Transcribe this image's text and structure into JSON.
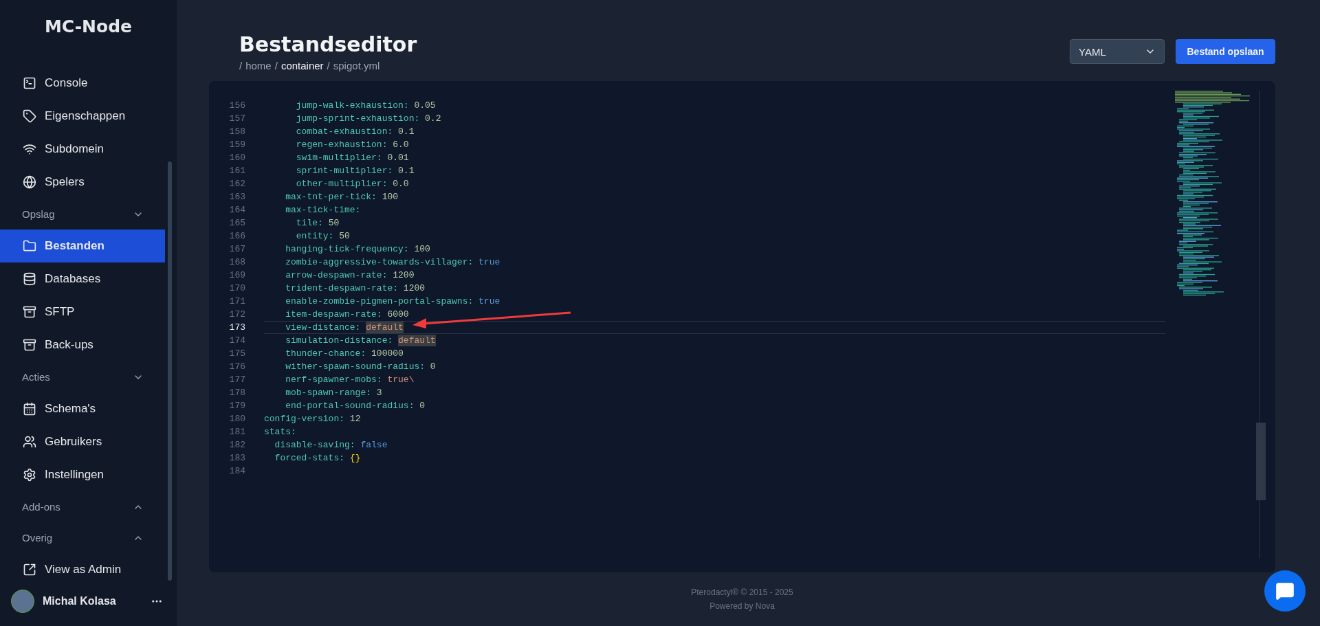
{
  "sidebar": {
    "logo": "MC-Node",
    "groups": [
      {
        "items": [
          {
            "label": "Console",
            "selected": false
          },
          {
            "label": "Eigenschappen",
            "selected": false
          },
          {
            "label": "Subdomein",
            "selected": false
          },
          {
            "label": "Spelers",
            "selected": false
          }
        ]
      },
      {
        "label": "Opslag",
        "expanded": true,
        "items": [
          {
            "label": "Bestanden",
            "selected": true
          },
          {
            "label": "Databases",
            "selected": false
          },
          {
            "label": "SFTP",
            "selected": false
          },
          {
            "label": "Back-ups",
            "selected": false
          }
        ]
      },
      {
        "label": "Acties",
        "expanded": true,
        "items": [
          {
            "label": "Schema's",
            "selected": false
          },
          {
            "label": "Gebruikers",
            "selected": false
          },
          {
            "label": "Instellingen",
            "selected": false
          }
        ]
      },
      {
        "label": "Add-ons",
        "expanded": false
      },
      {
        "label": "Overig",
        "expanded": false,
        "items": [
          {
            "label": "View as Admin",
            "selected": false
          }
        ]
      }
    ],
    "user": {
      "name": "Michal Kolasa"
    }
  },
  "header": {
    "title": "Bestandseditor",
    "breadcrumb": [
      {
        "label": "home",
        "highlighted": false
      },
      {
        "label": "container",
        "highlighted": true
      },
      {
        "label": "spigot.yml",
        "highlighted": false
      }
    ],
    "separator": "/",
    "language": "YAML",
    "save_button": "Bestand opslaan"
  },
  "editor": {
    "lines": [
      {
        "num": "156",
        "key": "      jump-walk-exhaustion:",
        "value": "0.05",
        "kind": "number",
        "current": false
      },
      {
        "num": "157",
        "key": "      jump-sprint-exhaustion:",
        "value": "0.2",
        "kind": "number",
        "current": false
      },
      {
        "num": "158",
        "key": "      combat-exhaustion:",
        "value": "0.1",
        "kind": "number",
        "current": false
      },
      {
        "num": "159",
        "key": "      regen-exhaustion:",
        "value": "6.0",
        "kind": "number",
        "current": false
      },
      {
        "num": "160",
        "key": "      swim-multiplier:",
        "value": "0.01",
        "kind": "number",
        "current": false
      },
      {
        "num": "161",
        "key": "      sprint-multiplier:",
        "value": "0.1",
        "kind": "number",
        "current": false
      },
      {
        "num": "162",
        "key": "      other-multiplier:",
        "value": "0.0",
        "kind": "number",
        "current": false
      },
      {
        "num": "163",
        "key": "    max-tnt-per-tick:",
        "value": "100",
        "kind": "number",
        "current": false
      },
      {
        "num": "164",
        "key": "    max-tick-time:",
        "kind": "none",
        "current": false
      },
      {
        "num": "165",
        "key": "      tile:",
        "value": "50",
        "kind": "number",
        "current": false
      },
      {
        "num": "166",
        "key": "      entity:",
        "value": "50",
        "kind": "number",
        "current": false
      },
      {
        "num": "167",
        "key": "    hanging-tick-frequency:",
        "value": "100",
        "kind": "number",
        "current": false
      },
      {
        "num": "168",
        "key": "    zombie-aggressive-towards-villager:",
        "value": "true",
        "kind": "bool",
        "current": false
      },
      {
        "num": "169",
        "key": "    arrow-despawn-rate:",
        "value": "1200",
        "kind": "number",
        "current": false
      },
      {
        "num": "170",
        "key": "    trident-despawn-rate:",
        "value": "1200",
        "kind": "number",
        "current": false
      },
      {
        "num": "171",
        "key": "    enable-zombie-pigmen-portal-spawns:",
        "value": "true",
        "kind": "bool",
        "current": false
      },
      {
        "num": "172",
        "key": "    item-despawn-rate:",
        "value": "6000",
        "kind": "number",
        "current": false
      },
      {
        "num": "173",
        "key": "    view-distance:",
        "value": "default",
        "kind": "match",
        "current": true
      },
      {
        "num": "174",
        "key": "    simulation-distance:",
        "value": "default",
        "kind": "match",
        "current": false
      },
      {
        "num": "175",
        "key": "    thunder-chance:",
        "value": "100000",
        "kind": "number",
        "current": false
      },
      {
        "num": "176",
        "key": "    wither-spawn-sound-radius:",
        "value": "0",
        "kind": "number",
        "current": false
      },
      {
        "num": "177",
        "key": "    nerf-spawner-mobs:",
        "value": "true\\",
        "kind": "string",
        "current": false
      },
      {
        "num": "178",
        "key": "    mob-spawn-range:",
        "value": "3",
        "kind": "number",
        "current": false
      },
      {
        "num": "179",
        "key": "    end-portal-sound-radius:",
        "value": "0",
        "kind": "number",
        "current": false
      },
      {
        "num": "180",
        "key": "config-version:",
        "value": "12",
        "kind": "number",
        "current": false
      },
      {
        "num": "181",
        "key": "stats:",
        "kind": "none",
        "current": false
      },
      {
        "num": "182",
        "key": "  disable-saving:",
        "value": "false",
        "kind": "bool",
        "current": false
      },
      {
        "num": "183",
        "key": "  forced-stats:",
        "value": "{}",
        "kind": "brace",
        "current": false
      },
      {
        "num": "184",
        "kind": "empty",
        "current": false
      }
    ]
  },
  "footer": {
    "copyright": "Pterodactyl® © 2015 - 2025",
    "powered": "Powered by Nova"
  }
}
